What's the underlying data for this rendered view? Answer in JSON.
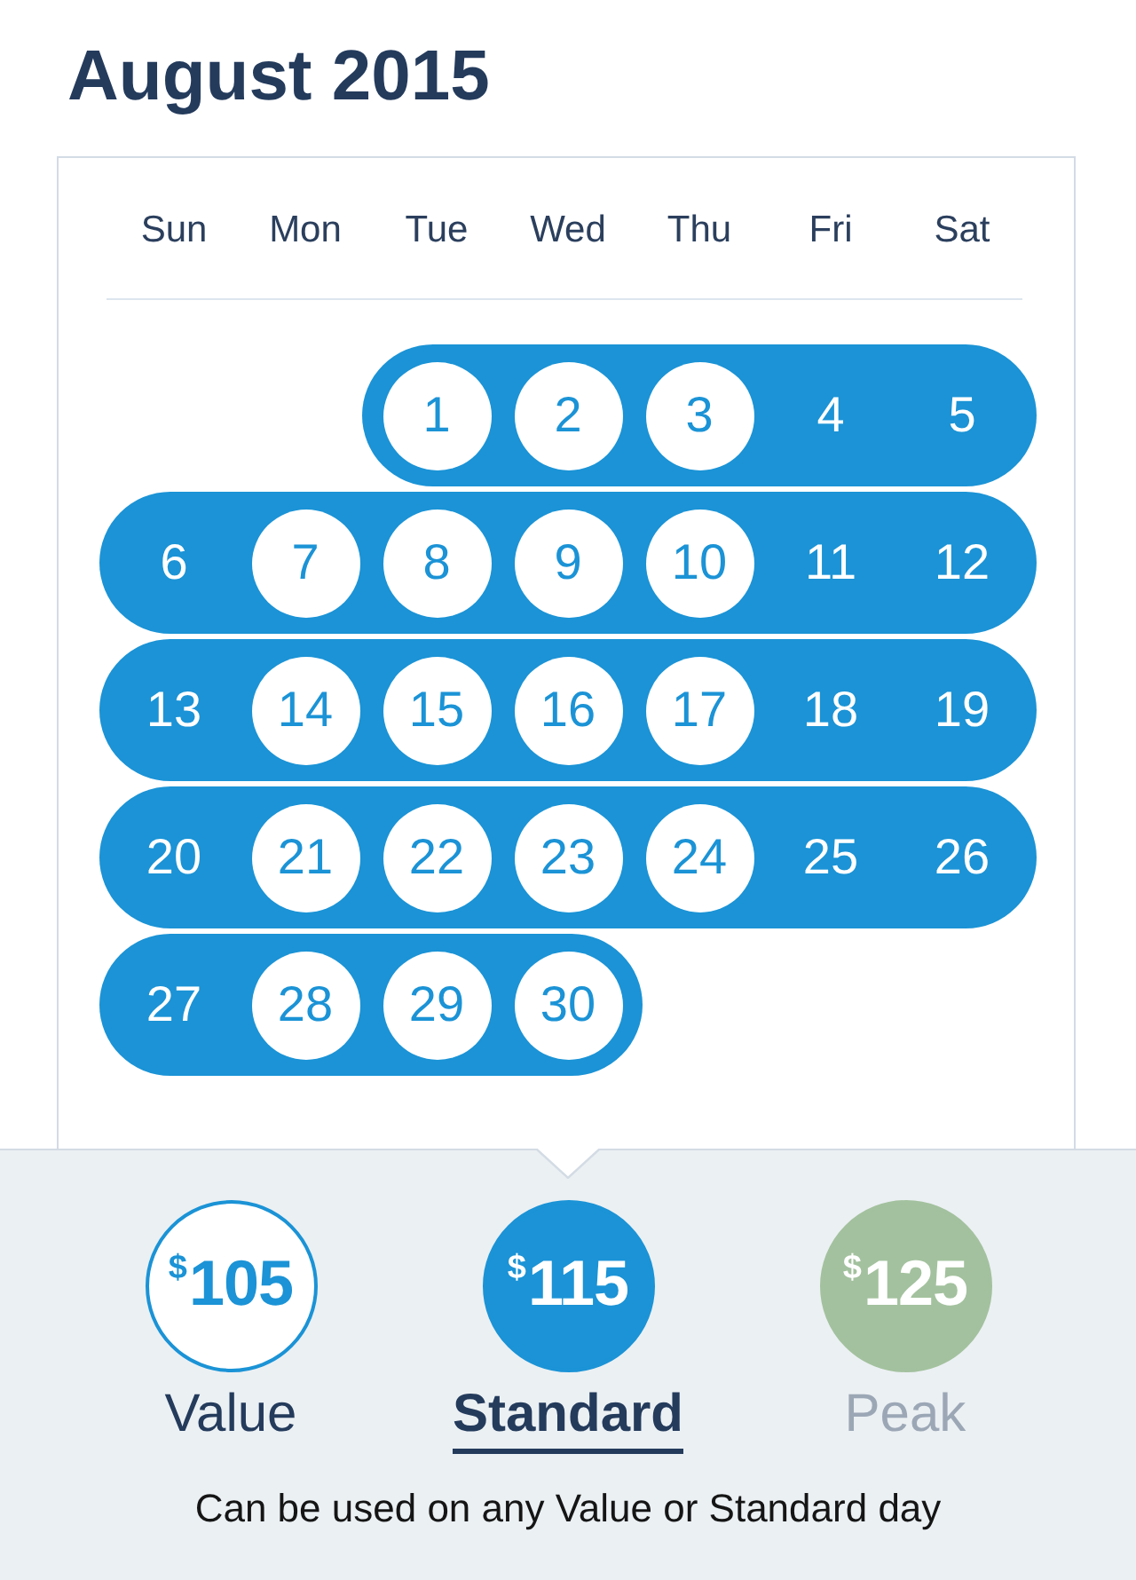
{
  "calendar": {
    "title": "August 2015",
    "weekdays": [
      "Sun",
      "Mon",
      "Tue",
      "Wed",
      "Thu",
      "Fri",
      "Sat"
    ],
    "weeks": [
      {
        "days": [
          {
            "label": "1",
            "kind": "value"
          },
          {
            "label": "2",
            "kind": "value"
          },
          {
            "label": "3",
            "kind": "value"
          },
          {
            "label": "4",
            "kind": "standard"
          },
          {
            "label": "5",
            "kind": "standard"
          }
        ]
      },
      {
        "days": [
          {
            "label": "6",
            "kind": "standard"
          },
          {
            "label": "7",
            "kind": "value"
          },
          {
            "label": "8",
            "kind": "value"
          },
          {
            "label": "9",
            "kind": "value"
          },
          {
            "label": "10",
            "kind": "value"
          },
          {
            "label": "11",
            "kind": "standard"
          },
          {
            "label": "12",
            "kind": "standard"
          }
        ]
      },
      {
        "days": [
          {
            "label": "13",
            "kind": "standard"
          },
          {
            "label": "14",
            "kind": "value"
          },
          {
            "label": "15",
            "kind": "value"
          },
          {
            "label": "16",
            "kind": "value"
          },
          {
            "label": "17",
            "kind": "value"
          },
          {
            "label": "18",
            "kind": "standard"
          },
          {
            "label": "19",
            "kind": "standard"
          }
        ]
      },
      {
        "days": [
          {
            "label": "20",
            "kind": "standard"
          },
          {
            "label": "21",
            "kind": "value"
          },
          {
            "label": "22",
            "kind": "value"
          },
          {
            "label": "23",
            "kind": "value"
          },
          {
            "label": "24",
            "kind": "value"
          },
          {
            "label": "25",
            "kind": "standard"
          },
          {
            "label": "26",
            "kind": "standard"
          }
        ]
      },
      {
        "days": [
          {
            "label": "27",
            "kind": "standard"
          },
          {
            "label": "28",
            "kind": "value"
          },
          {
            "label": "29",
            "kind": "value"
          },
          {
            "label": "30",
            "kind": "value"
          }
        ]
      }
    ]
  },
  "ticket_options": [
    {
      "currency": "$",
      "amount": "105",
      "label": "Value",
      "selected": false,
      "disabled": false
    },
    {
      "currency": "$",
      "amount": "115",
      "label": "Standard",
      "selected": true,
      "disabled": false
    },
    {
      "currency": "$",
      "amount": "125",
      "label": "Peak",
      "selected": false,
      "disabled": true
    }
  ],
  "note": "Can be used on any Value or Standard day"
}
